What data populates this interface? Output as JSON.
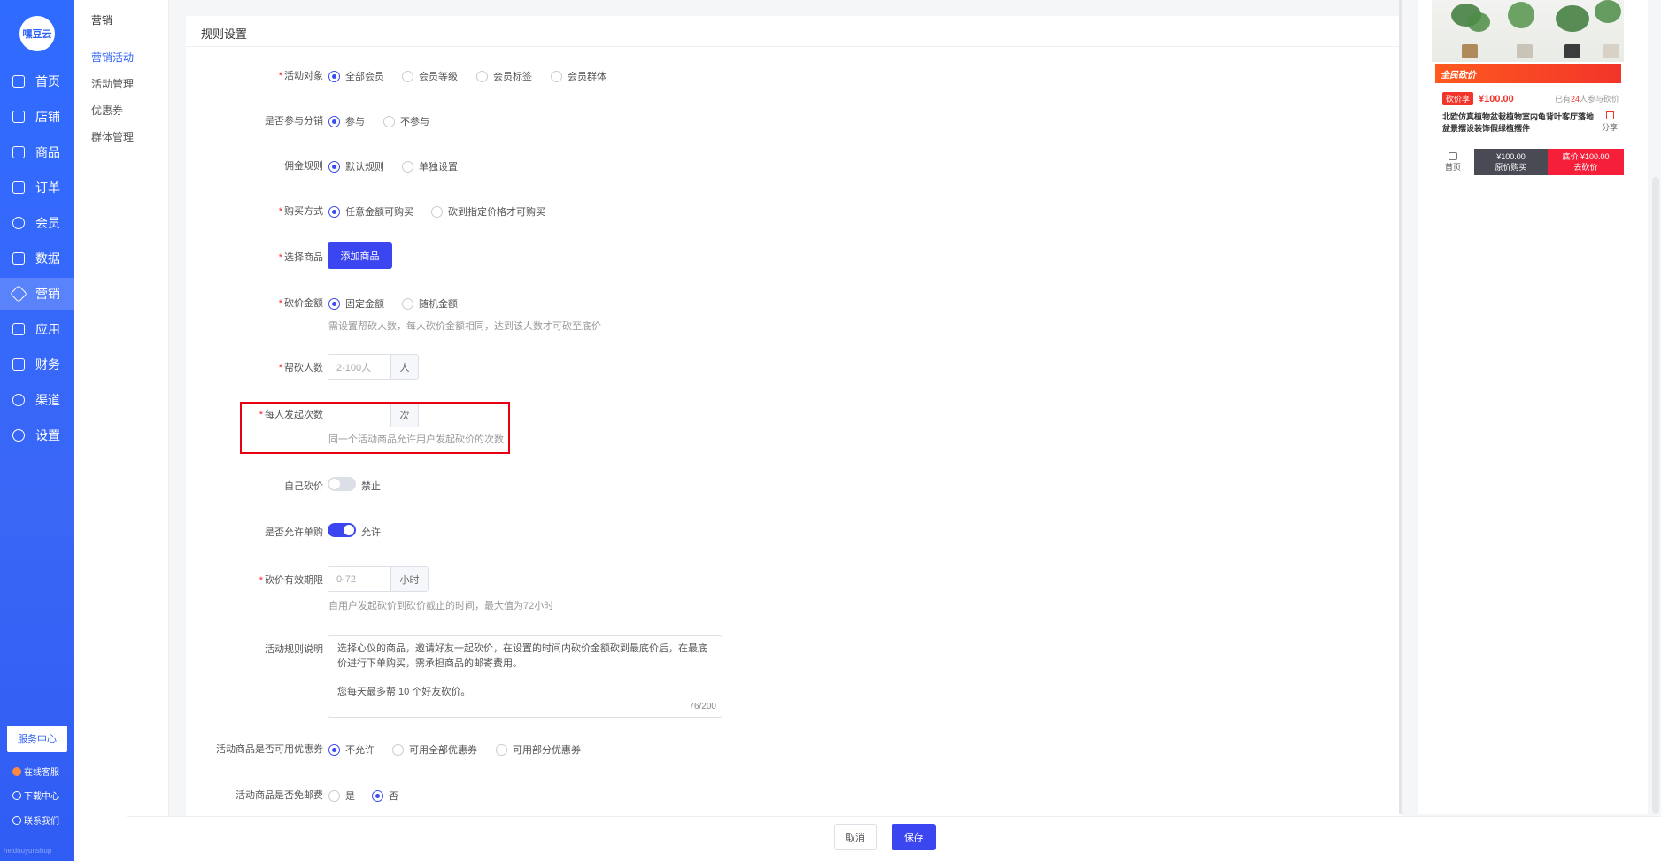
{
  "rail": {
    "logo": "嘿豆云",
    "items": [
      {
        "label": "首页",
        "icon": "home-icon"
      },
      {
        "label": "店铺",
        "icon": "store-icon"
      },
      {
        "label": "商品",
        "icon": "goods-icon"
      },
      {
        "label": "订单",
        "icon": "order-icon"
      },
      {
        "label": "会员",
        "icon": "member-icon"
      },
      {
        "label": "数据",
        "icon": "data-icon"
      },
      {
        "label": "营销",
        "icon": "tag-icon"
      },
      {
        "label": "应用",
        "icon": "app-icon"
      },
      {
        "label": "财务",
        "icon": "finance-icon"
      },
      {
        "label": "渠道",
        "icon": "channel-icon"
      },
      {
        "label": "设置",
        "icon": "gear-icon"
      }
    ],
    "service_center": "服务中心",
    "online_service": "在线客服",
    "download_center": "下载中心",
    "contact_us": "联系我们",
    "footer": "heidouyunshop"
  },
  "subnav": {
    "head": "营销",
    "items": [
      "营销活动",
      "活动管理",
      "优惠券",
      "群体管理"
    ]
  },
  "card": {
    "title": "规则设置"
  },
  "form": {
    "target": {
      "label": "活动对象",
      "options": [
        "全部会员",
        "会员等级",
        "会员标签",
        "会员群体"
      ]
    },
    "distribution": {
      "label": "是否参与分销",
      "options": [
        "参与",
        "不参与"
      ]
    },
    "commission": {
      "label": "佣金规则",
      "options": [
        "默认规则",
        "单独设置"
      ]
    },
    "purchase": {
      "label": "购买方式",
      "options": [
        "任意金额可购买",
        "砍到指定价格才可购买"
      ]
    },
    "select_goods": {
      "label": "选择商品",
      "button": "添加商品"
    },
    "bargain_amount": {
      "label": "砍价金额",
      "options": [
        "固定金额",
        "随机金额"
      ],
      "hint": "需设置帮砍人数，每人砍价金额相同，达到该人数才可砍至底价"
    },
    "helpers": {
      "label": "帮砍人数",
      "placeholder": "2-100人",
      "suffix": "人"
    },
    "per_user": {
      "label": "每人发起次数",
      "placeholder": "",
      "suffix": "次",
      "hint": "同一个活动商品允许用户发起砍价的次数"
    },
    "self_bargain": {
      "label": "自己砍价",
      "state": "禁止"
    },
    "single_buy": {
      "label": "是否允许单购",
      "state": "允许"
    },
    "validity": {
      "label": "砍价有效期限",
      "placeholder": "0-72",
      "suffix": "小时",
      "hint": "自用户发起砍价到砍价截止的时间，最大值为72小时"
    },
    "rule_desc": {
      "label": "活动规则说明",
      "line1": "选择心仪的商品，邀请好友一起砍价，在设置的时间内砍价金额砍到最底价后，在最底",
      "line2": "价进行下单购买，需承担商品的邮寄费用。",
      "line3": "您每天最多帮  10 个好友砍价。",
      "counter": "76/200"
    },
    "coupon": {
      "label": "活动商品是否可用优惠券",
      "options": [
        "不允许",
        "可用全部优惠券",
        "可用部分优惠券"
      ]
    },
    "free_ship": {
      "label": "活动商品是否免邮费",
      "options": [
        "是",
        "否"
      ]
    }
  },
  "footer": {
    "cancel": "取消",
    "save": "保存"
  },
  "preview": {
    "banner": "全民砍价",
    "tag": "砍价享",
    "price": "¥100.00",
    "joined_prefix": "已有",
    "joined_count": "24",
    "joined_suffix": "人参与砍价",
    "title": "北欧仿真植物盆栽植物室内龟背叶客厅落地盆景摆设装饰假绿植摆件",
    "share": "分享",
    "home": "首页",
    "orig_price": "¥100.00",
    "orig_label": "原价购买",
    "floor_price": "底价 ¥100.00",
    "bargain_label": "去砍价"
  },
  "colors": {
    "primary": "#3b45f0",
    "rail": "#2f6bff",
    "danger": "#f2342a",
    "highlight": "#e60012"
  }
}
